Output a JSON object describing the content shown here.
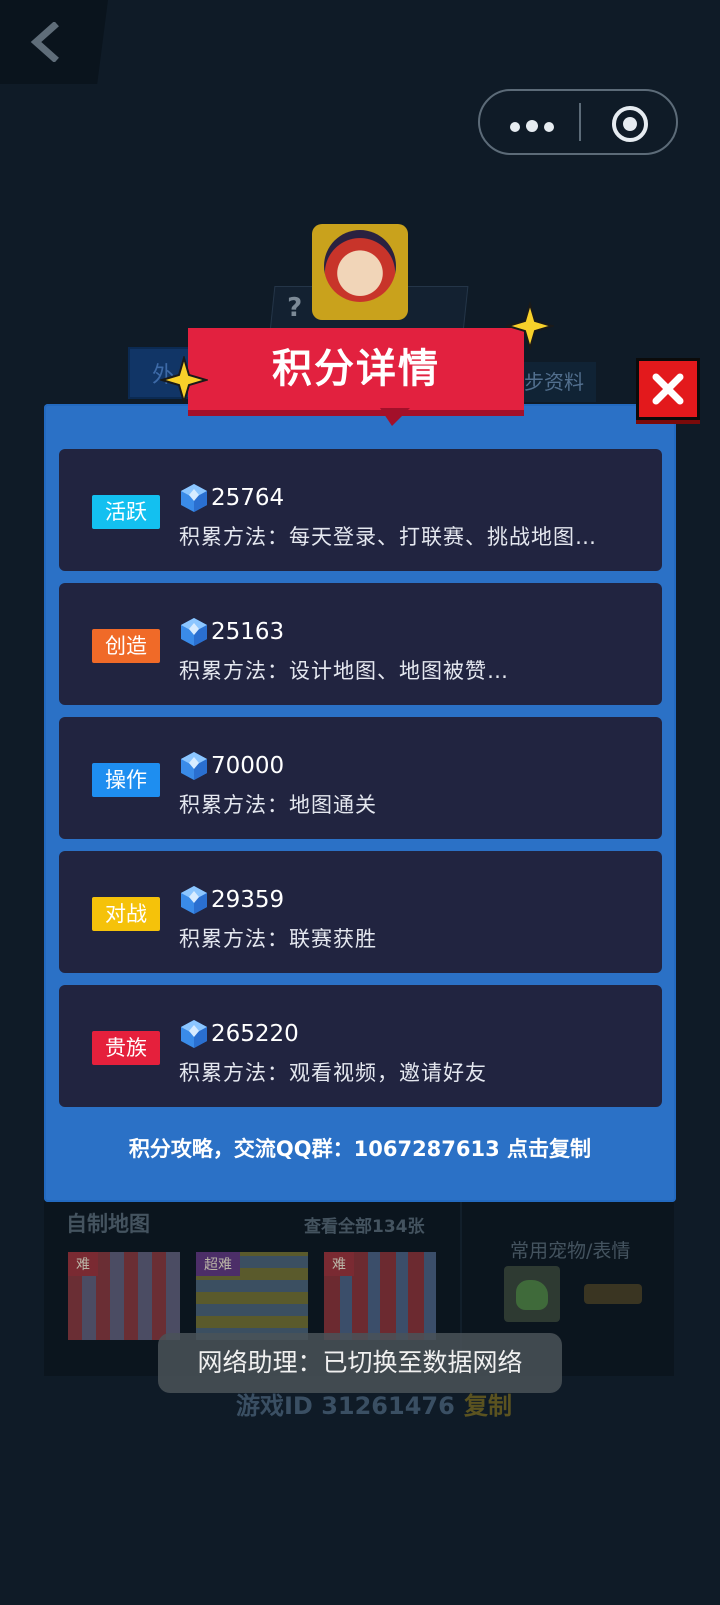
{
  "nav": {
    "back_icon": "chevron-left-icon",
    "menu_icon": "more-dots-icon",
    "close_mini_icon": "target-circle-icon"
  },
  "background": {
    "question_mark": "?",
    "left_tab": "外",
    "right_tab": "步资料",
    "maps_label": "自制地图",
    "view_all": "查看全部134张",
    "pets_label": "常用宠物/表情",
    "thumb_tags": [
      "难",
      "超难",
      "难"
    ],
    "game_id": "游戏ID 31261476",
    "game_id_copy": "复制"
  },
  "modal": {
    "title": "积分详情",
    "close_icon": "close-x-icon",
    "cards": [
      {
        "tag": "活跃",
        "tag_color": "#13c0f0",
        "points": "25764",
        "method": "积累方法：每天登录、打联赛、挑战地图…"
      },
      {
        "tag": "创造",
        "tag_color": "#f06a28",
        "points": "25163",
        "method": "积累方法：设计地图、地图被赞…"
      },
      {
        "tag": "操作",
        "tag_color": "#1e8ef0",
        "points": "70000",
        "method": "积累方法：地图通关"
      },
      {
        "tag": "对战",
        "tag_color": "#f5c20a",
        "points": "29359",
        "method": "积累方法：联赛获胜"
      },
      {
        "tag": "贵族",
        "tag_color": "#e5203c",
        "points": "265220",
        "method": "积累方法：观看视频，邀请好友"
      }
    ],
    "footer": "积分攻略，交流QQ群：1067287613 点击复制"
  },
  "toast": {
    "text": "网络助理：已切换至数据网络"
  },
  "colors": {
    "modal_blue": "#2b71c6",
    "card_bg": "#212440",
    "ribbon_red": "#e2213f",
    "close_red": "#e3191c"
  }
}
